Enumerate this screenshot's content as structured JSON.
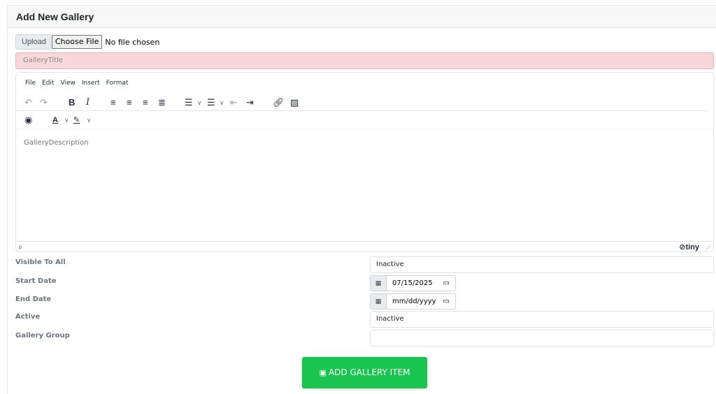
{
  "header": {
    "title": "Add New Gallery"
  },
  "upload": {
    "label": "Upload",
    "choose_button": "Choose File",
    "status": "No file chosen"
  },
  "gallery_title": {
    "placeholder": "GalleryTitle"
  },
  "editor": {
    "menu": [
      "File",
      "Edit",
      "View",
      "Insert",
      "Format"
    ],
    "placeholder": "GalleryDescription",
    "status_path": "p",
    "brand": "tiny"
  },
  "fields": {
    "visible_to_all": {
      "label": "Visible To All",
      "value": "Inactive"
    },
    "start_date": {
      "label": "Start Date",
      "value": "07/15/2025"
    },
    "end_date": {
      "label": "End Date",
      "value": "mm/dd/yyyy"
    },
    "active": {
      "label": "Active",
      "value": "Inactive"
    },
    "gallery_group": {
      "label": "Gallery Group",
      "value": ""
    }
  },
  "submit": {
    "label": "ADD GALLERY ITEM"
  },
  "colors": {
    "accent_green": "#1ac54f",
    "error_bg": "#f8d7da",
    "header_bg": "#f7f7f7"
  }
}
